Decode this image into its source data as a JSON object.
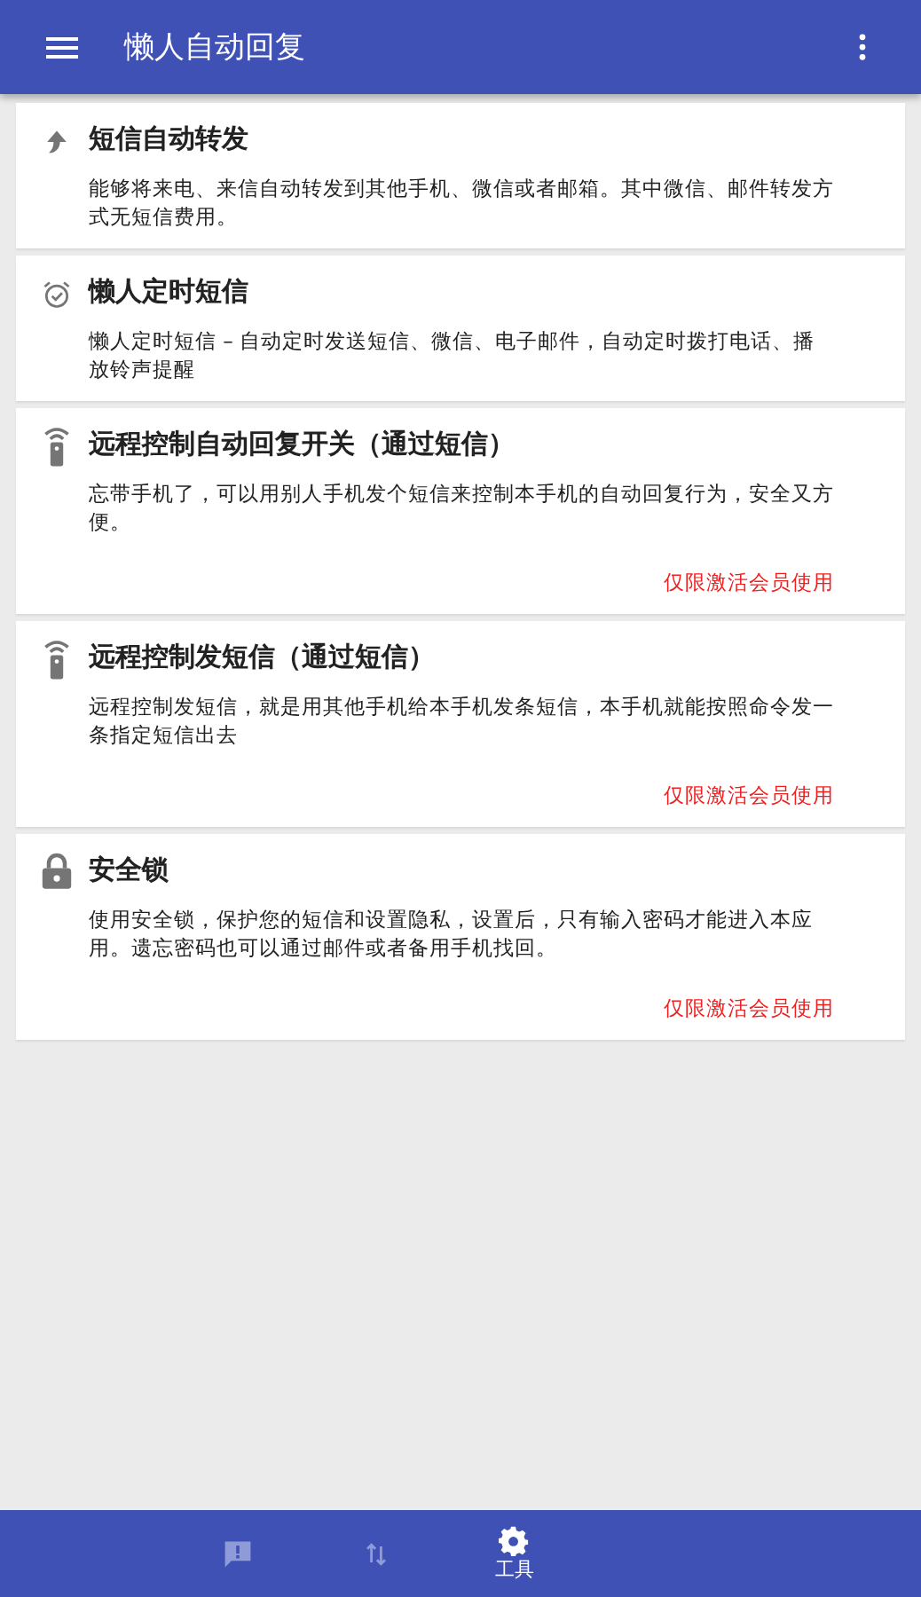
{
  "app_bar": {
    "title": "懒人自动回复"
  },
  "features": [
    {
      "kind": "forward",
      "title": "短信自动转发",
      "description": "能够将来电、来信自动转发到其他手机、微信或者邮箱。其中微信、邮件转发方式无短信费用。"
    },
    {
      "kind": "alarm",
      "title": "懒人定时短信",
      "description": "懒人定时短信 – 自动定时发送短信、微信、电子邮件，自动定时拨打电话、播放铃声提醒"
    },
    {
      "kind": "remote",
      "title": "远程控制自动回复开关（通过短信）",
      "description": "忘带手机了，可以用别人手机发个短信来控制本手机的自动回复行为，安全又方便。",
      "note": "仅限激活会员使用"
    },
    {
      "kind": "remote",
      "title": "远程控制发短信（通过短信）",
      "description": "远程控制发短信，就是用其他手机给本手机发条短信，本手机就能按照命令发一条指定短信出去",
      "note": "仅限激活会员使用"
    },
    {
      "kind": "lock",
      "title": "安全锁",
      "description": "使用安全锁，保护您的短信和设置隐私，设置后，只有输入密码才能进入本应用。遗忘密码也可以通过邮件或者备用手机找回。",
      "note": "仅限激活会员使用"
    }
  ],
  "bottom_nav": [
    {
      "kind": "alert",
      "selected": false
    },
    {
      "kind": "swap",
      "selected": false
    },
    {
      "kind": "gear",
      "label": "工具",
      "selected": true
    }
  ]
}
